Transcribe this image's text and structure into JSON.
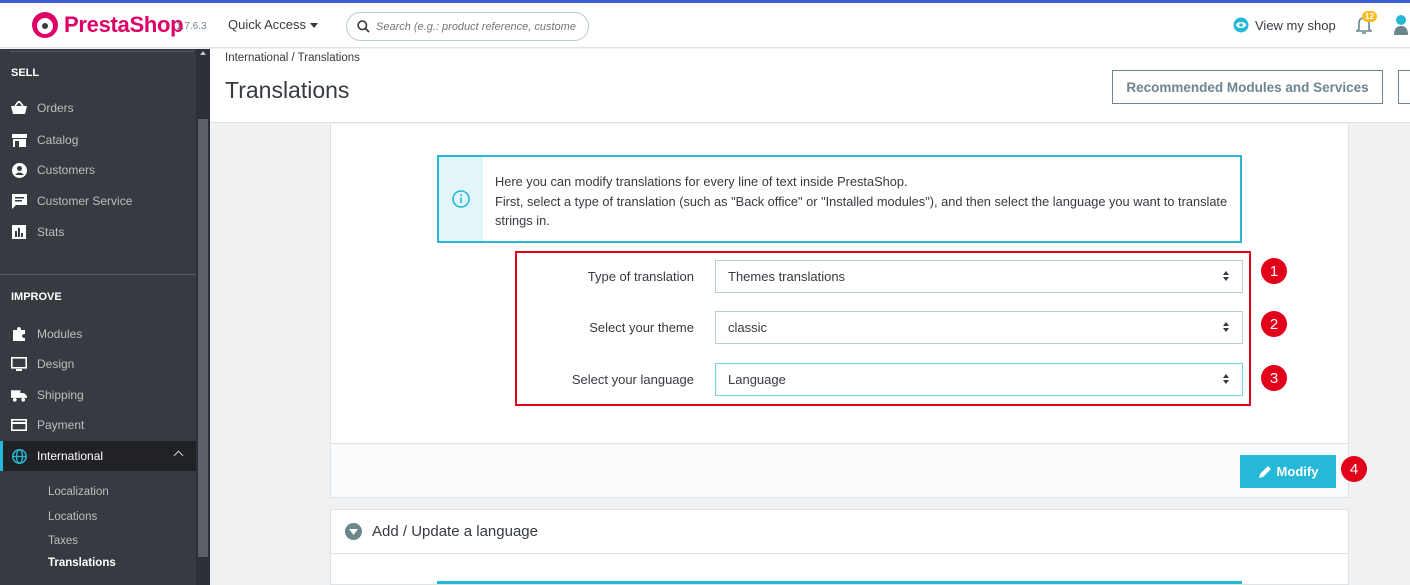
{
  "topbar": {
    "logo_text": "PrestaShop",
    "version": "1.7.6.3",
    "quick_access": "Quick Access",
    "search_placeholder": "Search (e.g.: product reference, custome",
    "view_shop": "View my shop",
    "notification_count": "12"
  },
  "sidebar": {
    "sell_title": "SELL",
    "sell_items": [
      {
        "label": "Orders",
        "icon": "basket-icon"
      },
      {
        "label": "Catalog",
        "icon": "store-icon"
      },
      {
        "label": "Customers",
        "icon": "user-circle-icon"
      },
      {
        "label": "Customer Service",
        "icon": "chat-icon"
      },
      {
        "label": "Stats",
        "icon": "bar-chart-icon"
      }
    ],
    "improve_title": "IMPROVE",
    "improve_items": [
      {
        "label": "Modules",
        "icon": "puzzle-icon"
      },
      {
        "label": "Design",
        "icon": "monitor-icon"
      },
      {
        "label": "Shipping",
        "icon": "truck-icon"
      },
      {
        "label": "Payment",
        "icon": "card-icon"
      },
      {
        "label": "International",
        "icon": "globe-icon"
      }
    ],
    "sub_items": [
      "Localization",
      "Locations",
      "Taxes",
      "Translations"
    ]
  },
  "header": {
    "breadcrumb": "International  /  Translations",
    "title": "Translations",
    "recommended_button": "Recommended Modules and Services"
  },
  "info": {
    "line1": "Here you can modify translations for every line of text inside PrestaShop.",
    "line2": "First, select a type of translation (such as \"Back office\" or \"Installed modules\"), and then select the language you want to translate strings in."
  },
  "form": {
    "rows": [
      {
        "label": "Type of translation",
        "value": "Themes translations",
        "badge": "1"
      },
      {
        "label": "Select your theme",
        "value": "classic",
        "badge": "2"
      },
      {
        "label": "Select your language",
        "value": "Language",
        "badge": "3"
      }
    ],
    "modify_button": "Modify",
    "modify_badge": "4"
  },
  "add_language": {
    "title": "Add / Update a language"
  },
  "colors": {
    "brand": "#df0067",
    "accent": "#25b9d7",
    "highlight": "#e2001a",
    "sidebar_bg": "#363a41"
  }
}
